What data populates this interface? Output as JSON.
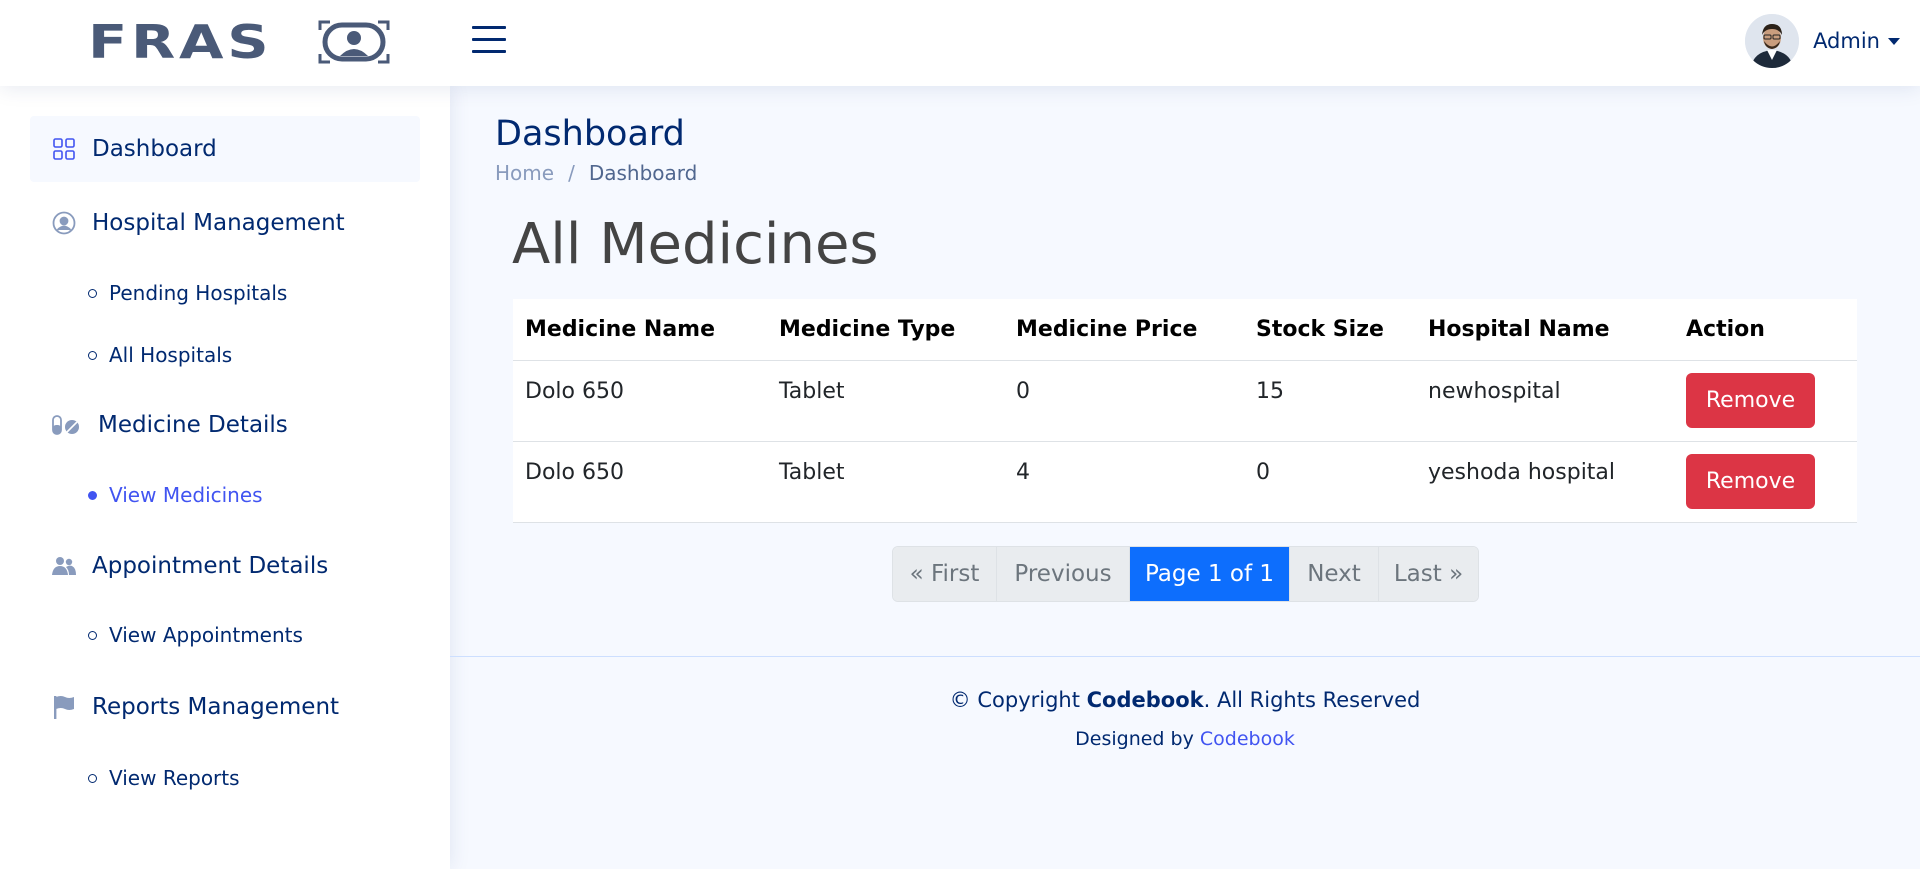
{
  "header": {
    "logo_text": "FRAS",
    "profile_name": "Admin"
  },
  "sidebar": {
    "items": [
      {
        "label": "Dashboard",
        "icon": "grid-icon"
      },
      {
        "label": "Hospital Management",
        "icon": "person-circle-icon"
      },
      {
        "label": "Medicine Details",
        "icon": "capsule-icon"
      },
      {
        "label": "Appointment Details",
        "icon": "people-icon"
      },
      {
        "label": "Reports Management",
        "icon": "flag-icon"
      }
    ],
    "sub": {
      "pending_hospitals": "Pending Hospitals",
      "all_hospitals": "All Hospitals",
      "view_medicines": "View Medicines",
      "view_appointments": "View Appointments",
      "view_reports": "View Reports"
    }
  },
  "main": {
    "page_title": "Dashboard",
    "breadcrumb": {
      "home": "Home",
      "sep": "/",
      "current": "Dashboard"
    },
    "heading": "All Medicines",
    "table": {
      "headers": [
        "Medicine Name",
        "Medicine Type",
        "Medicine Price",
        "Stock Size",
        "Hospital Name",
        "Action"
      ],
      "rows": [
        [
          "Dolo 650",
          "Tablet",
          "0",
          "15",
          "newhospital",
          "Remove"
        ],
        [
          "Dolo 650",
          "Tablet",
          "4",
          "0",
          "yeshoda hospital",
          "Remove"
        ]
      ]
    },
    "pagination": {
      "first": "« First",
      "previous": "Previous",
      "current": "Page 1 of 1",
      "next": "Next",
      "last": "Last »"
    }
  },
  "footer": {
    "copyright_prefix": "© Copyright ",
    "company": "Codebook",
    "copyright_suffix": ". All Rights Reserved",
    "designed_prefix": "Designed by ",
    "designed_by": "Codebook"
  },
  "colors": {
    "primary": "#012970",
    "accent": "#4154f1",
    "danger": "#dc3545",
    "pagination_active": "#0d6efd"
  }
}
